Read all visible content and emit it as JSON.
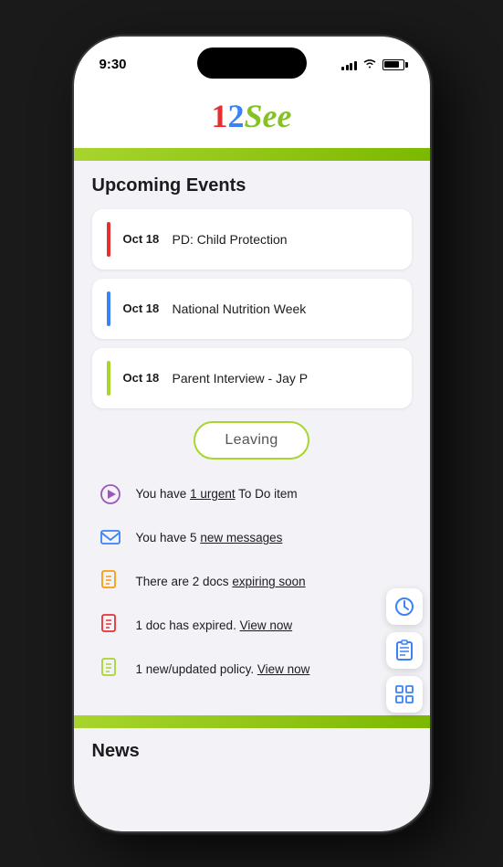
{
  "status_bar": {
    "time": "9:30",
    "signal": "full",
    "wifi": "on",
    "battery": "high"
  },
  "header": {
    "logo_1": "1",
    "logo_2": "2",
    "logo_see": "See"
  },
  "upcoming_events": {
    "title": "Upcoming Events",
    "events": [
      {
        "date": "Oct 18",
        "name": "PD: Child Protection",
        "accent_color": "#e63030"
      },
      {
        "date": "Oct 18",
        "name": "National Nutrition Week",
        "accent_color": "#3b82f6"
      },
      {
        "date": "Oct 18",
        "name": "Parent Interview - Jay P",
        "accent_color": "#a8d52e"
      }
    ]
  },
  "leaving_button": {
    "label": "Leaving"
  },
  "notifications": [
    {
      "icon": "▷",
      "icon_color": "#9b59b6",
      "text": "You have ",
      "highlight": "1 urgent",
      "text2": " To Do item"
    },
    {
      "icon": "✉",
      "icon_color": "#3b82f6",
      "text": "You have 5 ",
      "highlight": "new messages",
      "text2": ""
    },
    {
      "icon": "📄",
      "icon_color": "#f59e0b",
      "text": "There are 2 docs ",
      "highlight": "expiring soon",
      "text2": ""
    },
    {
      "icon": "📄",
      "icon_color": "#e63030",
      "text": "1 doc has expired. ",
      "highlight": "View now",
      "text2": ""
    },
    {
      "icon": "📄",
      "icon_color": "#a8d52e",
      "text": "1 new/updated policy. ",
      "highlight": "View now",
      "text2": ""
    }
  ],
  "news": {
    "title": "News"
  },
  "fab_buttons": [
    {
      "icon": "🕐",
      "name": "clock-icon"
    },
    {
      "icon": "📋",
      "name": "clipboard-icon"
    },
    {
      "icon": "🔢",
      "name": "grid-icon"
    }
  ]
}
